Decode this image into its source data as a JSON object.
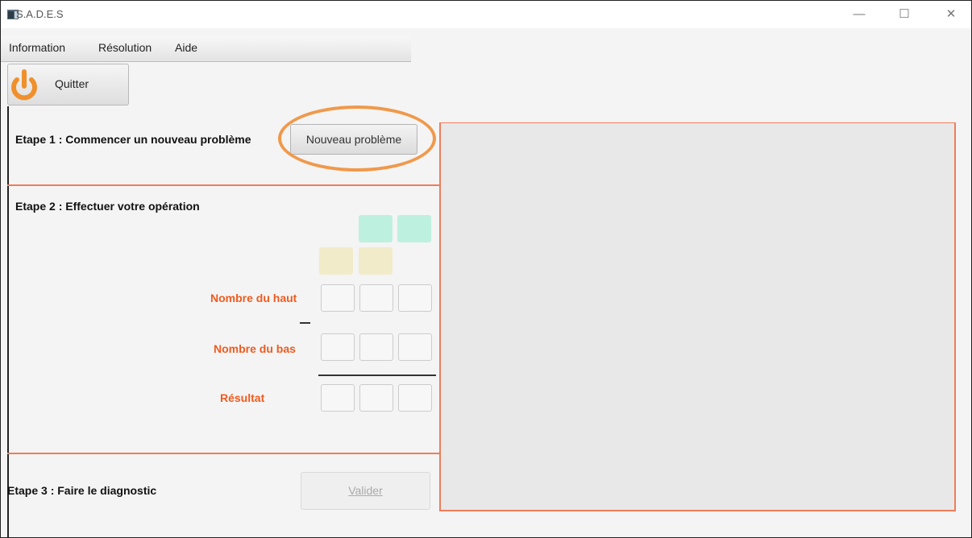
{
  "window": {
    "title": "S.A.D.E.S",
    "controls": {
      "minimize": "—",
      "maximize": "☐",
      "close": "✕"
    }
  },
  "menu": {
    "items": [
      {
        "label": "Information"
      },
      {
        "label": "Résolution"
      },
      {
        "label": "Aide"
      }
    ]
  },
  "toolbar": {
    "quit_label": "Quitter",
    "quit_icon": "power-icon",
    "accent_color": "#f0902c"
  },
  "step1": {
    "label": "Etape 1 : Commencer un nouveau problème",
    "button_label": "Nouveau problème"
  },
  "step2": {
    "label": "Etape 2 : Effectuer votre opération",
    "top_number_label": "Nombre du haut",
    "bottom_number_label": "Nombre du bas",
    "operator": "−",
    "result_label": "Résultat",
    "colors": {
      "carry_cells": "#bef0e0",
      "borrow_cells": "#f1ebc9",
      "labels": "#ef5b20"
    }
  },
  "step3": {
    "label": "Etape 3 : Faire le diagnostic",
    "button_label": "Valider"
  }
}
